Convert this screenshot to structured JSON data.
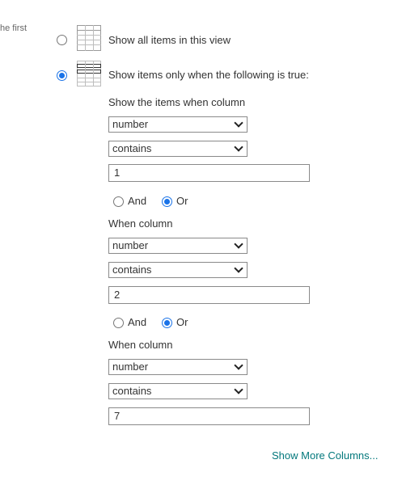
{
  "side_text": "he first",
  "options": {
    "all_label": "Show all items in this view",
    "filtered_label": "Show items only when the following is true:"
  },
  "filters": {
    "first_heading": "Show the items when column",
    "next_heading": "When column",
    "conditions": [
      {
        "column": "number",
        "operator": "contains",
        "value": "1"
      },
      {
        "column": "number",
        "operator": "contains",
        "value": "2"
      },
      {
        "column": "number",
        "operator": "contains",
        "value": "7"
      }
    ],
    "and_label": "And",
    "or_label": "Or"
  },
  "show_more": "Show More Columns...",
  "colors": {
    "accent": "#1a73e8",
    "link": "#03787c"
  }
}
